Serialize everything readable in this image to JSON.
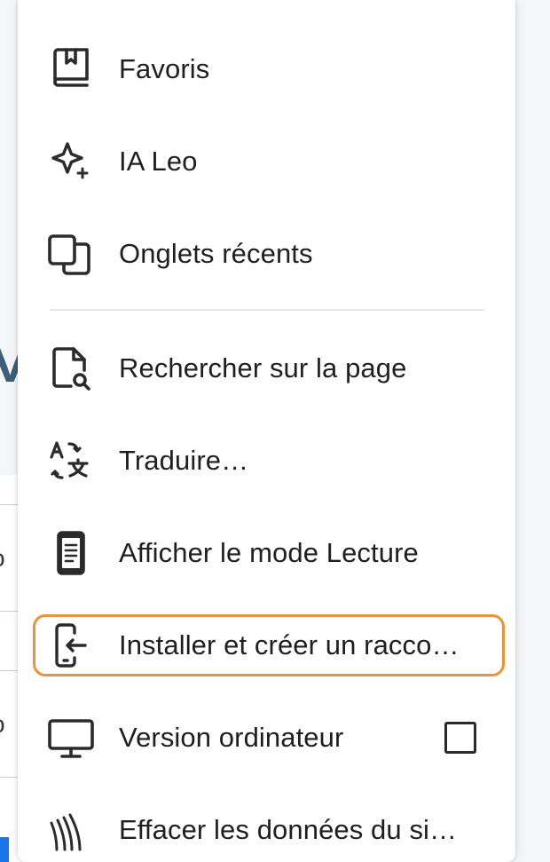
{
  "background": {
    "partial_letter": "V",
    "fragment_1": "o",
    "fragment_2": "o"
  },
  "menu": {
    "items": [
      {
        "id": "favoris",
        "label": "Favoris",
        "icon": "bookmarks-icon"
      },
      {
        "id": "ia-leo",
        "label": "IA Leo",
        "icon": "sparkle-icon"
      },
      {
        "id": "onglets-recents",
        "label": "Onglets récents",
        "icon": "devices-icon"
      },
      {
        "id": "rechercher",
        "label": "Rechercher sur la page",
        "icon": "find-in-page-icon"
      },
      {
        "id": "traduire",
        "label": "Traduire…",
        "icon": "translate-icon"
      },
      {
        "id": "mode-lecture",
        "label": "Afficher le mode Lecture",
        "icon": "reader-mode-icon"
      },
      {
        "id": "installer",
        "label": "Installer et créer un racco…",
        "icon": "install-app-icon",
        "highlighted": true
      },
      {
        "id": "version-ordinateur",
        "label": "Version ordinateur",
        "icon": "desktop-icon",
        "checked": false
      },
      {
        "id": "effacer",
        "label": "Effacer les données du si…",
        "icon": "clear-data-icon"
      }
    ]
  },
  "colors": {
    "highlight": "#e8953a",
    "text": "#1f1f1f",
    "icon": "#2b2b2b"
  }
}
